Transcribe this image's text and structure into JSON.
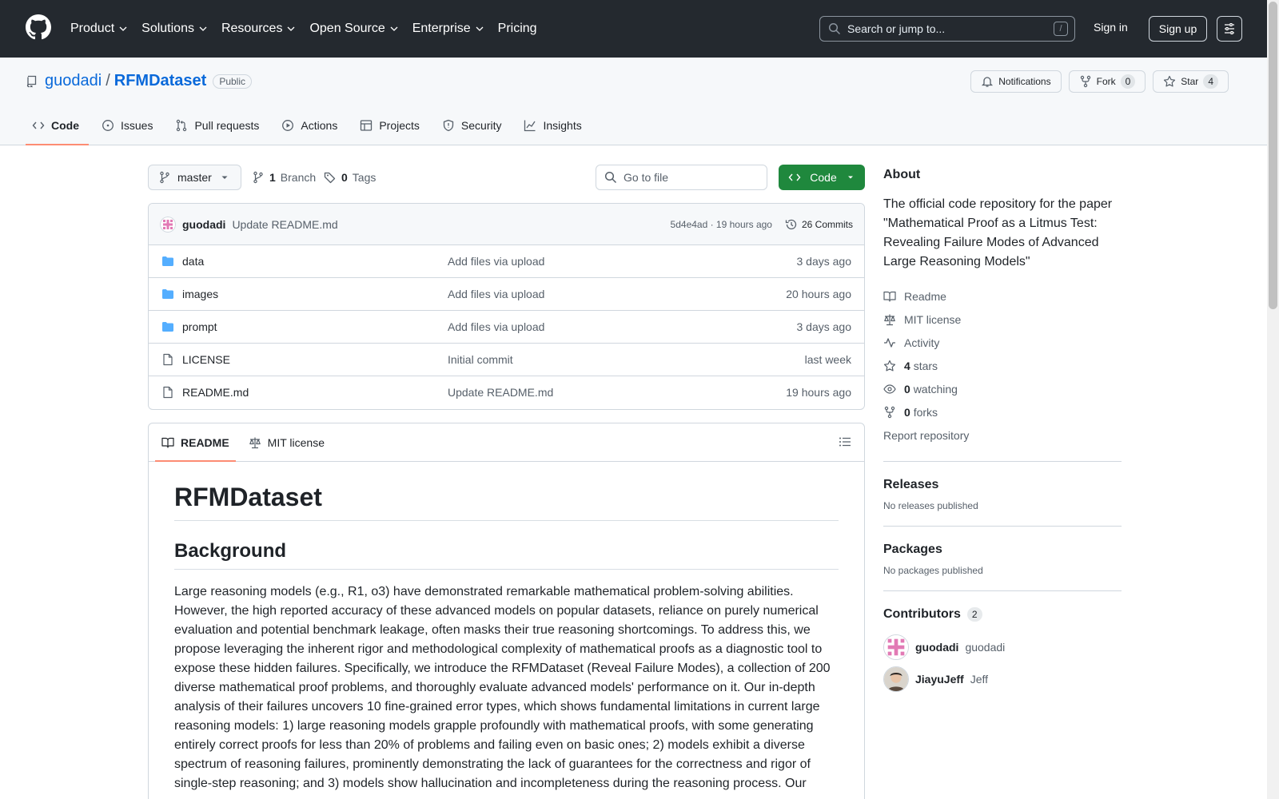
{
  "header": {
    "nav": [
      {
        "label": "Product",
        "caret": true
      },
      {
        "label": "Solutions",
        "caret": true
      },
      {
        "label": "Resources",
        "caret": true
      },
      {
        "label": "Open Source",
        "caret": true
      },
      {
        "label": "Enterprise",
        "caret": true
      },
      {
        "label": "Pricing",
        "caret": false
      }
    ],
    "search_placeholder": "Search or jump to...",
    "search_shortcut": "/",
    "signin": "Sign in",
    "signup": "Sign up"
  },
  "repo": {
    "owner": "guodadi",
    "separator": "/",
    "name": "RFMDataset",
    "visibility": "Public",
    "notifications_label": "Notifications",
    "fork_label": "Fork",
    "fork_count": "0",
    "star_label": "Star",
    "star_count": "4",
    "tabs": [
      {
        "label": "Code",
        "icon": "code-icon",
        "active": true
      },
      {
        "label": "Issues",
        "icon": "issue-icon"
      },
      {
        "label": "Pull requests",
        "icon": "pull-request-icon"
      },
      {
        "label": "Actions",
        "icon": "play-icon"
      },
      {
        "label": "Projects",
        "icon": "table-icon"
      },
      {
        "label": "Security",
        "icon": "shield-icon"
      },
      {
        "label": "Insights",
        "icon": "graph-icon"
      }
    ]
  },
  "filebar": {
    "branch": "master",
    "branch_count": "1",
    "branch_label": "Branch",
    "tag_count": "0",
    "tag_label": "Tags",
    "goto_placeholder": "Go to file",
    "code_button": "Code"
  },
  "latest_commit": {
    "author": "guodadi",
    "message": "Update README.md",
    "hash_time": "5d4e4ad · 19 hours ago",
    "commits": "26 Commits"
  },
  "files": [
    {
      "type": "dir",
      "name": "data",
      "commit": "Add files via upload",
      "time": "3 days ago"
    },
    {
      "type": "dir",
      "name": "images",
      "commit": "Add files via upload",
      "time": "20 hours ago"
    },
    {
      "type": "dir",
      "name": "prompt",
      "commit": "Add files via upload",
      "time": "3 days ago"
    },
    {
      "type": "file",
      "name": "LICENSE",
      "commit": "Initial commit",
      "time": "last week"
    },
    {
      "type": "file",
      "name": "README.md",
      "commit": "Update README.md",
      "time": "19 hours ago"
    }
  ],
  "readme": {
    "tab_readme": "README",
    "tab_license": "MIT license",
    "title": "RFMDataset",
    "h2": "Background",
    "paragraph": "Large reasoning models (e.g., R1, o3) have demonstrated remarkable mathematical problem-solving abilities. However, the high reported accuracy of these advanced models on popular datasets, reliance on purely numerical evaluation and potential benchmark leakage, often masks their true reasoning shortcomings. To address this, we propose leveraging the inherent rigor and methodological complexity of mathematical proofs as a diagnostic tool to expose these hidden failures. Specifically, we introduce the RFMDataset (Reveal Failure Modes), a collection of 200 diverse mathematical proof problems, and thoroughly evaluate advanced models' performance on it. Our in-depth analysis of their failures uncovers 10 fine-grained error types, which shows fundamental limitations in current large reasoning models: 1) large reasoning models grapple profoundly with mathematical proofs, with some generating entirely correct proofs for less than 20% of problems and failing even on basic ones; 2) models exhibit a diverse spectrum of reasoning failures, prominently demonstrating the lack of guarantees for the correctness and rigor of single-step reasoning; and 3) models show hallucination and incompleteness during the reasoning process. Our"
  },
  "about": {
    "heading": "About",
    "description": "The official code repository for the paper \"Mathematical Proof as a Litmus Test: Revealing Failure Modes of Advanced Large Reasoning Models\"",
    "readme": "Readme",
    "license": "MIT license",
    "activity": "Activity",
    "stars_count": "4",
    "stars_label": "stars",
    "watching_count": "0",
    "watching_label": "watching",
    "forks_count": "0",
    "forks_label": "forks",
    "report": "Report repository"
  },
  "releases": {
    "heading": "Releases",
    "text": "No releases published"
  },
  "packages": {
    "heading": "Packages",
    "text": "No packages published"
  },
  "contributors": {
    "heading": "Contributors",
    "count": "2",
    "list": [
      {
        "login": "guodadi",
        "name": "guodadi"
      },
      {
        "login": "JiayuJeff",
        "name": "Jeff"
      }
    ]
  },
  "colors": {
    "header_bg": "#24292f",
    "link": "#0969da",
    "primary_btn": "#1f883d",
    "tab_underline": "#fd8c73"
  }
}
